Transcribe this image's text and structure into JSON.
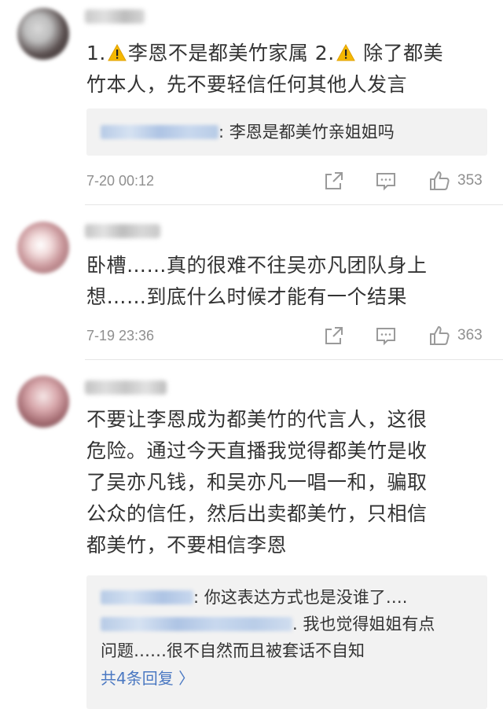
{
  "comments": [
    {
      "text_line1": "1.",
      "text_line1b": "李恩不是都美竹家属  2.",
      "text_line1c": " 除了都美",
      "text_line2": "竹本人，先不要轻信任何其他人发言",
      "reply_quote": ": 李恩是都美竹亲姐姐吗",
      "time": "7-20 00:12",
      "likes": "353"
    },
    {
      "text_line1": "卧槽……真的很难不往吴亦凡团队身上",
      "text_line2": "想……到底什么时候才能有一个结果",
      "time": "7-19 23:36",
      "likes": "363"
    },
    {
      "text_line1": "不要让李恩成为都美竹的代言人，这很",
      "text_line2": "危险。通过今天直播我觉得都美竹是收",
      "text_line3": "了吴亦凡钱，和吴亦凡一唱一和，骗取",
      "text_line4": "公众的信任，然后出卖都美竹，只相信",
      "text_line5": "都美竹，不要相信李恩",
      "reply1": ": 你这表达方式也是没谁了….",
      "reply2a": ". 我也觉得姐姐有点",
      "reply2b": "问题……很不自然而且被套话不自知",
      "more_replies": "共4条回复 〉"
    }
  ],
  "colors": {
    "accent": "#4a78c2",
    "meta": "#8f8f8f",
    "quote_bg": "#f2f2f2",
    "warning": "#f5b800"
  },
  "icons": [
    "share-icon",
    "comment-icon",
    "like-icon",
    "warning-icon"
  ]
}
